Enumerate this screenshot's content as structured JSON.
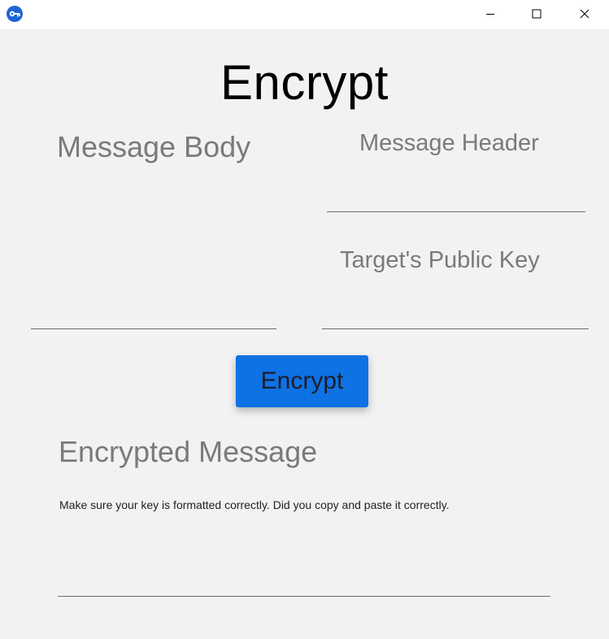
{
  "window": {
    "icon": "key-icon",
    "controls": [
      "minimize-icon",
      "maximize-icon",
      "close-icon"
    ]
  },
  "page": {
    "title": "Encrypt"
  },
  "form": {
    "message_body_label": "Message Body",
    "message_body_value": "",
    "message_header_label": "Message Header",
    "message_header_value": "",
    "public_key_label": "Target's Public Key",
    "public_key_value": ""
  },
  "actions": {
    "encrypt_label": "Encrypt"
  },
  "output": {
    "label": "Encrypted Message",
    "status": "Make sure your key is formatted correctly. Did you copy and paste it correctly.",
    "value": ""
  },
  "colors": {
    "accent": "#0e72e4",
    "background": "#f2f2f2",
    "label_gray": "#7a7a7a"
  }
}
